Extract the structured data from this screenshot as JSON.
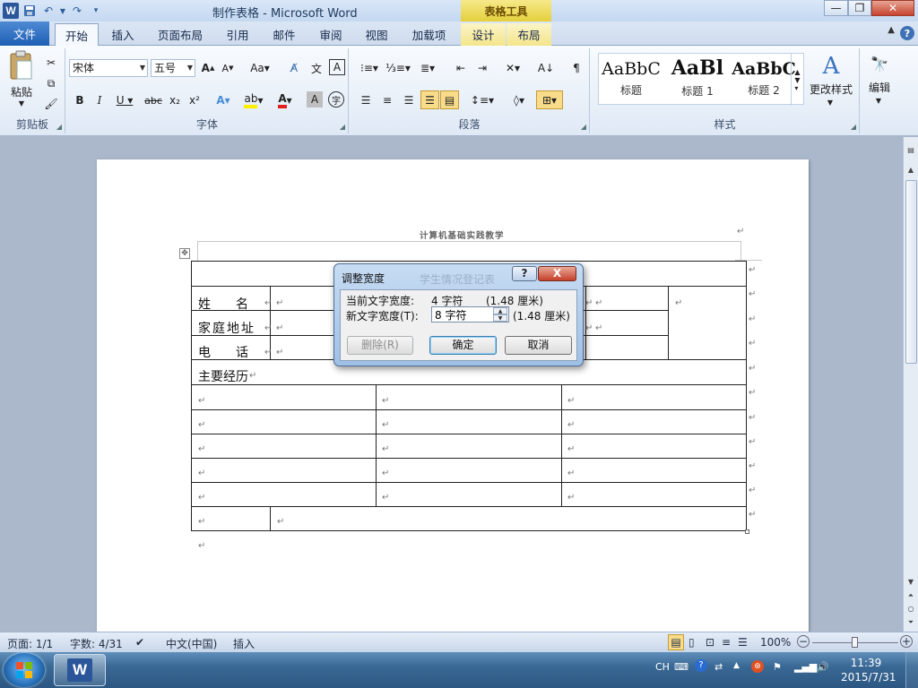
{
  "titlebar": {
    "title": "制作表格 - Microsoft Word",
    "contextual_tab_header": "表格工具",
    "qat": {
      "word_logo": "W",
      "save_icon": "save-icon",
      "undo_icon": "undo-icon",
      "redo_icon": "redo-icon"
    }
  },
  "tabs": [
    {
      "label": "文件"
    },
    {
      "label": "开始"
    },
    {
      "label": "插入"
    },
    {
      "label": "页面布局"
    },
    {
      "label": "引用"
    },
    {
      "label": "邮件"
    },
    {
      "label": "审阅"
    },
    {
      "label": "视图"
    },
    {
      "label": "加载项"
    },
    {
      "label": "设计"
    },
    {
      "label": "布局"
    }
  ],
  "ribbon": {
    "clipboard": {
      "paste_label": "粘贴",
      "group_label": "剪贴板"
    },
    "font": {
      "font_name": "宋体",
      "font_size": "五号",
      "group_label": "字体"
    },
    "paragraph": {
      "group_label": "段落"
    },
    "styles": {
      "group_label": "样式",
      "items": [
        {
          "sample": "AaBbC",
          "name": "标题"
        },
        {
          "sample": "AaBl",
          "name": "标题 1"
        },
        {
          "sample": "AaBbC",
          "name": "标题 2"
        }
      ],
      "change_styles_label": "更改样式"
    },
    "editing": {
      "label": "编辑"
    }
  },
  "document": {
    "heading": "计算机基础实践教学",
    "table": {
      "name_label": "姓　　名",
      "address_label": "家庭地址",
      "phone_label": "电　　话",
      "experience_label": "主要经历"
    }
  },
  "dialog": {
    "title": "调整宽度",
    "ghost_title": "学生情况登记表",
    "help": "?",
    "close": "X",
    "current_width_label": "当前文字宽度:",
    "current_width_value": "4 字符",
    "current_width_cm": "(1.48 厘米)",
    "new_width_label": "新文字宽度(T):",
    "new_width_value": "8 字符",
    "new_width_cm": "(1.48 厘米)",
    "delete_label": "删除(R)",
    "ok_label": "确定",
    "cancel_label": "取消"
  },
  "statusbar": {
    "page": "页面: 1/1",
    "words": "字数: 4/31",
    "language": "中文(中国)",
    "mode": "插入",
    "zoom": "100%"
  },
  "taskbar": {
    "ime": "CH",
    "time": "11:39",
    "date": "2015/7/31"
  },
  "colors": {
    "file_tab": "#2b63b5",
    "contextual_tab": "#e8d552",
    "word_brand": "#2b579a"
  }
}
